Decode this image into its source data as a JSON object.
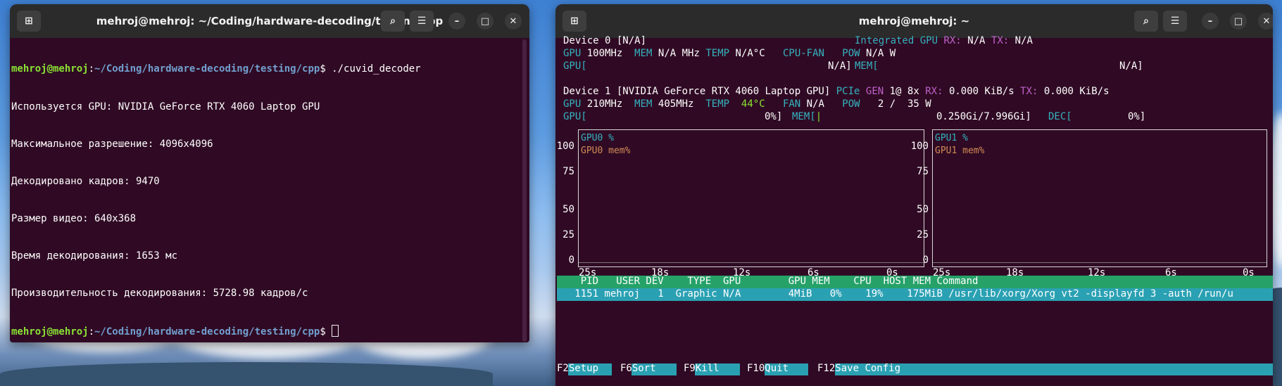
{
  "left_window": {
    "title": "mehroj@mehroj: ~/Coding/hardware-decoding/testing/cpp",
    "prompt_user": "mehroj@mehroj",
    "prompt_sep": ":",
    "prompt_path": "~/Coding/hardware-decoding/testing/cpp",
    "prompt_dollar": "$ ",
    "command": "./cuvid_decoder",
    "output": [
      "Используется GPU: NVIDIA GeForce RTX 4060 Laptop GPU",
      "Максимальное разрешение: 4096x4096",
      "Декодировано кадров: 9470",
      "Размер видео: 640x368",
      "Время декодирования: 1653 мс",
      "Производительность декодирования: 5728.98 кадров/с"
    ]
  },
  "right_window": {
    "title": "mehroj@mehroj: ~",
    "device0": {
      "header": "Device 0 [N/A]",
      "integrated": "Integrated GPU",
      "rx_label": "RX:",
      "rx": "N/A",
      "tx_label": "TX:",
      "tx": "N/A",
      "gpu_label": "GPU",
      "gpu_clock": "100MHz",
      "mem_label": "MEM",
      "mem_clock": "N/A MHz",
      "temp_label": "TEMP",
      "temp": "N/A°C",
      "fan_label": "CPU-FAN",
      "pow_label": "POW",
      "pow": "N/A W",
      "gpu_bar_label": "GPU[",
      "gpu_bar_val": "N/A]",
      "mem_bar_label": "MEM[",
      "mem_bar_val": "N/A]"
    },
    "device1": {
      "header": "Device 1 [NVIDIA GeForce RTX 4060 Laptop GPU]",
      "pcie": "PCIe",
      "gen_label": "GEN",
      "gen": "1@ 8x",
      "rx_label": "RX:",
      "rx": "0.000 KiB/s",
      "tx_label": "TX:",
      "tx": "0.000 KiB/s",
      "gpu_label": "GPU",
      "gpu_clock": "210MHz",
      "mem_label": "MEM",
      "mem_clock": "405MHz",
      "temp_label": "TEMP",
      "temp": "44°C",
      "fan_label": "FAN",
      "fan": "N/A",
      "pow_label": "POW",
      "pow": "2 /  35 W",
      "gpu_bar_label": "GPU[",
      "gpu_bar_val": "0%]",
      "mem_bar_label": "MEM[",
      "mem_bar_mark": "|",
      "mem_bar_val": "0.250Gi/7.996Gi]",
      "dec_label": "DEC[",
      "dec_val": "0%]"
    },
    "plots": [
      {
        "series1": "GPU0 %",
        "series2": "GPU0 mem%"
      },
      {
        "series1": "GPU1 %",
        "series2": "GPU1 mem%"
      }
    ],
    "y_ticks": [
      "100",
      "75",
      "50",
      "25",
      "0"
    ],
    "x_ticks": [
      "25s",
      "18s",
      "12s",
      "6s",
      "0s"
    ],
    "table_header": "    PID   USER DEV    TYPE  GPU        GPU MEM    CPU  HOST MEM Command",
    "table_row": "   1151 mehroj   1  Graphic N/A        4MiB   0%    19%    175MiB /usr/lib/xorg/Xorg vt2 -displayfd 3 -auth /run/u",
    "fkeys": [
      {
        "key": "F2",
        "label": "Setup"
      },
      {
        "key": "F6",
        "label": "Sort"
      },
      {
        "key": "F9",
        "label": "Kill"
      },
      {
        "key": "F10",
        "label": "Quit"
      },
      {
        "key": "F12",
        "label": "Save Config"
      }
    ]
  }
}
